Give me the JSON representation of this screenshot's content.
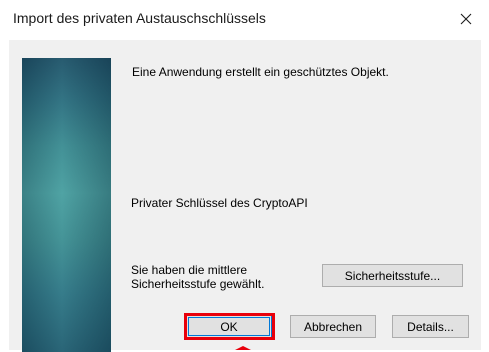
{
  "window": {
    "title": "Import des privaten Austauschschlüssels",
    "close_glyph": "close-icon"
  },
  "message": {
    "line1": "Eine Anwendung erstellt ein geschütztes Objekt.",
    "key_label": "Privater Schlüssel des CryptoAPI",
    "security_level_text": "Sie haben die mittlere Sicherheitsstufe gewählt."
  },
  "buttons": {
    "security_level": "Sicherheitsstufe...",
    "ok": "OK",
    "cancel": "Abbrechen",
    "details": "Details..."
  },
  "annotation": {
    "highlight_color": "#e8000b",
    "highlight_target": "ok-button"
  },
  "colors": {
    "dialog_background": "#f0f0f0",
    "button_face": "#e1e1e1",
    "focus_blue": "#0078d7",
    "side_panel_teal": "#3d8b91"
  }
}
